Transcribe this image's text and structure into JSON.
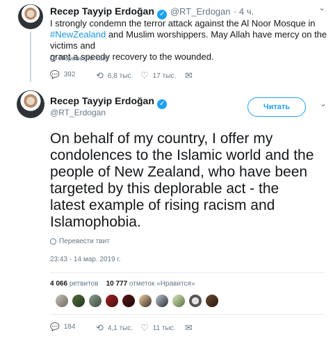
{
  "tweet1": {
    "name": "Recep Tayyip Erdoğan",
    "handle": "@RT_Erdogan",
    "time": "· 4 ч.",
    "text_part1": "I strongly condemn the terror attack against the Al Noor Mosque in",
    "hashtag": "#NewZealand",
    "text_part2": " and Muslim worshippers. May Allah have mercy on the victims and",
    "text_part3": "grant a speedy recovery to the wounded.",
    "translate": "Перевести твит",
    "replies": "392",
    "retweets": "6,8 тыс.",
    "likes": "17 тыс."
  },
  "tweet2": {
    "name": "Recep Tayyip Erdoğan",
    "handle": "@RT_Erdogan",
    "follow_label": "Читать",
    "text_lines": [
      "On behalf of my country, I offer my",
      "condolences to the Islamic world and the",
      "people of New Zealand, who have been",
      "targeted by this deplorable act - the",
      "latest example of rising racism and",
      "Islamophobia."
    ],
    "translate": "Перевести твит",
    "timestamp": "23:43 - 14 мар. 2019 г.",
    "retweet_count": "4 066",
    "retweet_label": "ретвитов",
    "like_count": "10 777",
    "like_label": "отметок «Нравится»",
    "replies": "184",
    "retweets": "4,1 тыс.",
    "likes": "11 тыс."
  },
  "icons": {
    "reply": "💬",
    "retweet": "⟲",
    "like": "♡",
    "dm": "✉",
    "chevron": "⌄",
    "check": "✓"
  },
  "colors": {
    "accent": "#1da1f2",
    "hashtag": "#1b95e0",
    "muted": "#657786"
  }
}
